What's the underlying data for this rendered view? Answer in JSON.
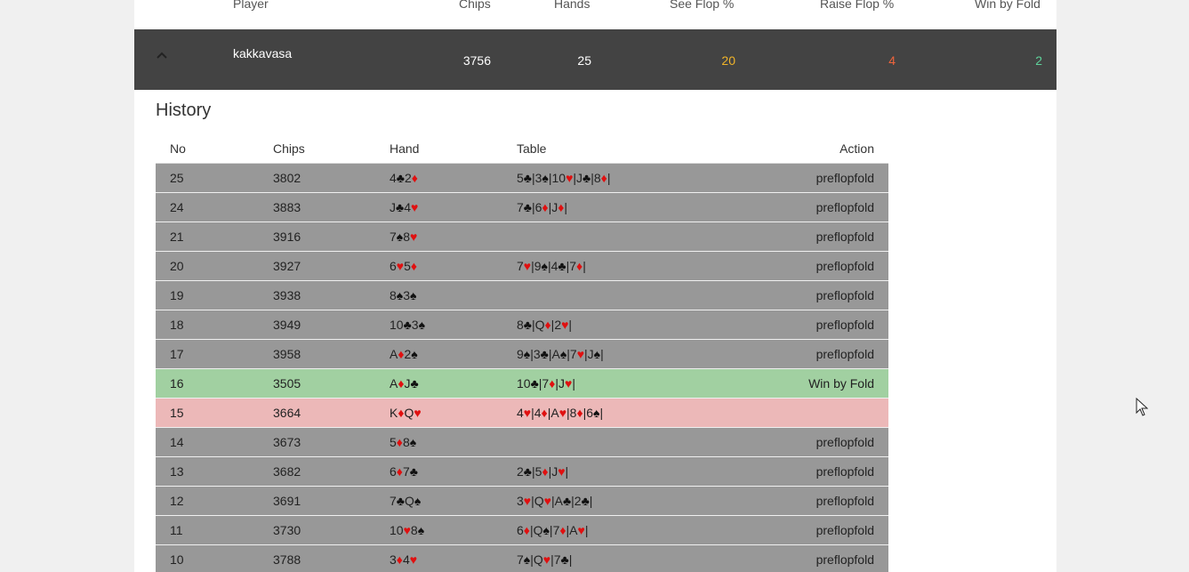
{
  "header": {
    "player": "Player",
    "chips": "Chips",
    "hands": "Hands",
    "see_flop": "See Flop %",
    "raise_flop": "Raise Flop %",
    "win_by_fold": "Win by Fold"
  },
  "player_row": {
    "name": "kakkavasa",
    "chips": "3756",
    "hands": "25",
    "see_flop": "20",
    "raise_flop": "4",
    "win_by_fold": "2",
    "colors": {
      "see_flop": "#f0b429",
      "raise_flop": "#f0643c",
      "win_by_fold": "#5fd39b"
    }
  },
  "history": {
    "title": "History",
    "columns": [
      "No",
      "Chips",
      "Hand",
      "Table",
      "Action"
    ],
    "rows": [
      {
        "no": "25",
        "chips": "3802",
        "hand": "4♣2♦",
        "table": "5♣|3♠|10♥|J♣|8♦|",
        "action": "preflopfold",
        "status": "normal"
      },
      {
        "no": "24",
        "chips": "3883",
        "hand": "J♣4♥",
        "table": "7♣|6♦|J♦|",
        "action": "preflopfold",
        "status": "normal"
      },
      {
        "no": "21",
        "chips": "3916",
        "hand": "7♠8♥",
        "table": "",
        "action": "preflopfold",
        "status": "normal"
      },
      {
        "no": "20",
        "chips": "3927",
        "hand": "6♥5♦",
        "table": "7♥|9♠|4♣|7♦|",
        "action": "preflopfold",
        "status": "normal"
      },
      {
        "no": "19",
        "chips": "3938",
        "hand": "8♠3♠",
        "table": "",
        "action": "preflopfold",
        "status": "normal"
      },
      {
        "no": "18",
        "chips": "3949",
        "hand": "10♣3♠",
        "table": "8♣|Q♦|2♥|",
        "action": "preflopfold",
        "status": "normal"
      },
      {
        "no": "17",
        "chips": "3958",
        "hand": "A♦2♠",
        "table": "9♠|3♣|A♠|7♥|J♠|",
        "action": "preflopfold",
        "status": "normal"
      },
      {
        "no": "16",
        "chips": "3505",
        "hand": "A♦J♣",
        "table": "10♣|7♦|J♥|",
        "action": "Win by Fold",
        "status": "win"
      },
      {
        "no": "15",
        "chips": "3664",
        "hand": "K♦Q♥",
        "table": "4♥|4♦|A♥|8♦|6♠|",
        "action": "",
        "status": "loss"
      },
      {
        "no": "14",
        "chips": "3673",
        "hand": "5♦8♠",
        "table": "",
        "action": "preflopfold",
        "status": "normal"
      },
      {
        "no": "13",
        "chips": "3682",
        "hand": "6♦7♣",
        "table": "2♣|5♦|J♥|",
        "action": "preflopfold",
        "status": "normal"
      },
      {
        "no": "12",
        "chips": "3691",
        "hand": "7♣Q♠",
        "table": "3♥|Q♥|A♣|2♣|",
        "action": "preflopfold",
        "status": "normal"
      },
      {
        "no": "11",
        "chips": "3730",
        "hand": "10♥8♠",
        "table": "6♦|Q♠|7♦|A♥|",
        "action": "preflopfold",
        "status": "normal"
      },
      {
        "no": "10",
        "chips": "3788",
        "hand": "3♦4♥",
        "table": "7♠|Q♥|7♣|",
        "action": "preflopfold",
        "status": "normal"
      }
    ]
  },
  "icons": {
    "collapse": "chevron-up-icon",
    "cursor": "mouse-cursor-icon"
  }
}
